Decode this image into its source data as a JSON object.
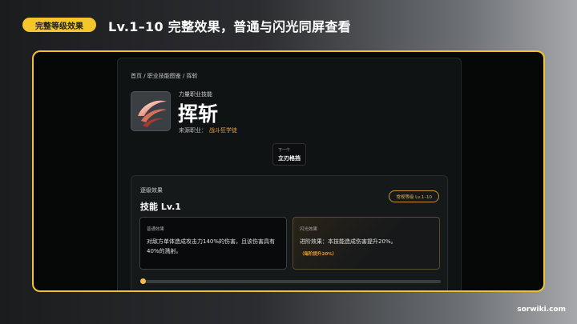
{
  "slide": {
    "badge": "完整等级效果",
    "title": "Lv.1–10 完整效果，普通与闪光同屏查看",
    "watermark": "sorwiki.com"
  },
  "breadcrumb": "首页 / 职业技能图鉴 / 挥斩",
  "skill": {
    "category": "力量职业技能",
    "name": "挥斩",
    "source_label": "来源职业：",
    "source_job": "战斗狂学徒",
    "icon": "slash-icon"
  },
  "next": {
    "label": "下一个",
    "name": "立刃格挡"
  },
  "effects": {
    "section_title": "逐级效果",
    "level_badge": "常规等级 Lv.1–10",
    "level_title": "技能 Lv.1",
    "normal": {
      "title": "普通效果",
      "desc": "对敌方单体造成攻击力140%的伤害，且该伤害具有40%的溅射。"
    },
    "flash": {
      "title": "闪光效果",
      "desc": "进阶效果：本技能造成伤害提升20%。",
      "extra": "（每阶提升20%）"
    },
    "slider": {
      "level": 1,
      "min": 1,
      "max": 10
    }
  },
  "colors": {
    "accent": "#f4c62e",
    "highlight": "#e9a33c"
  }
}
